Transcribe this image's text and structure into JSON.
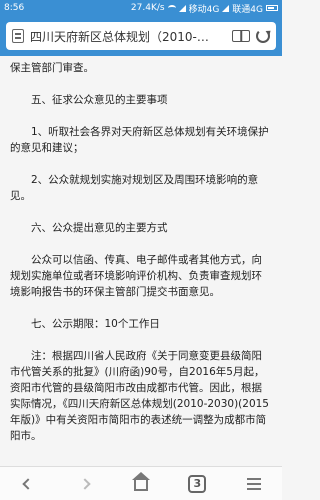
{
  "status_bar": {
    "time": "8:56",
    "net_speed": "27.4K/s",
    "carrier1": "移动4G",
    "carrier2": "联通4G"
  },
  "browser": {
    "page_title": "四川天府新区总体规划（2010-…"
  },
  "content": {
    "p0": "保主管部门审查。",
    "p1": "五、征求公众意见的主要事项",
    "p2": "1、听取社会各界对天府新区总体规划有关环境保护的意见和建议；",
    "p3": "2、公众就规划实施对规划区及周围环境影响的意见。",
    "p4": "六、公众提出意见的主要方式",
    "p5": "公众可以信函、传真、电子邮件或者其他方式，向规划实施单位或者环境影响评价机构、负责审查规划环境影响报告书的环保主管部门提交书面意见。",
    "p6": "七、公示期限：10个工作日",
    "p7": "注：根据四川省人民政府《关于同意变更县级简阳市代管关系的批复》(川府函)90号，自2016年5月起，资阳市代管的县级简阳市改由成都市代管。因此，根据实际情况，《四川天府新区总体规划(2010-2030)(2015年版)》中有关资阳市简阳市的表述统一调整为成都市简阳市。"
  },
  "bottom_nav": {
    "tab_count": "3"
  }
}
